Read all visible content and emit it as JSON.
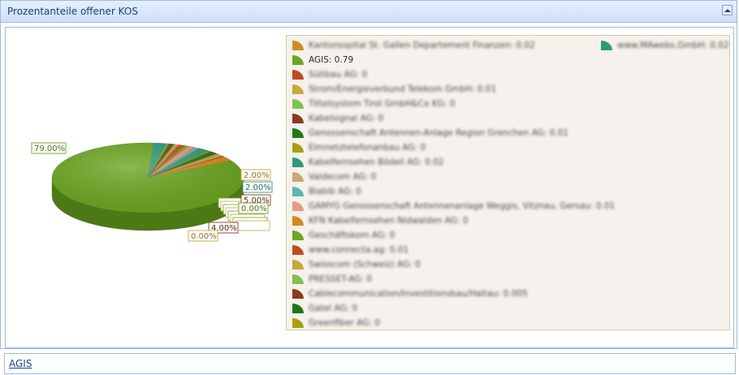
{
  "panel": {
    "title": "Prozentanteile offener KOS"
  },
  "footer": {
    "link_label": "AGIS"
  },
  "colors": {
    "header_text": "#15428b",
    "border": "#99bbe8",
    "legend_bg": "#f5f1ec"
  },
  "chart_data": {
    "type": "pie",
    "style": "3d",
    "legend_placement": "right",
    "series": [
      {
        "name": "Kantonsspital St. Gallen Departement Finanzen: 0.02",
        "value": 0.02,
        "color": "#d18b1c"
      },
      {
        "name": "AGIS: 0.79",
        "value": 0.79,
        "color": "#6aa61e"
      },
      {
        "name": "Sütibau AG: 0",
        "value": 0,
        "color": "#c34a1e"
      },
      {
        "name": "Strom/Energieverbund Telekom GmbH: 0.01",
        "value": 0.01,
        "color": "#c8a83a"
      },
      {
        "name": "Tittelsystem Tirol GmbH&Co KG: 0",
        "value": 0,
        "color": "#7ec24a"
      },
      {
        "name": "Kabelsignal AG: 0",
        "value": 0,
        "color": "#8b3a1e"
      },
      {
        "name": "Genossenschaft Antennen-Anlage Region Grenchen AG: 0.01",
        "value": 0.01,
        "color": "#1a7a0e"
      },
      {
        "name": "Elmnetztelefonanbau AG: 0",
        "value": 0,
        "color": "#a8a010"
      },
      {
        "name": "Kabelfernsehen Bödeli AG: 0.02",
        "value": 0.02,
        "color": "#2f9a7a"
      },
      {
        "name": "Valdecom AG: 0",
        "value": 0,
        "color": "#c8a878"
      },
      {
        "name": "Biabib AG: 0",
        "value": 0,
        "color": "#5ab8b0"
      },
      {
        "name": "GAMYG Genossenschaft Antennenanlage Weggis, Vitznau, Gersau: 0.01",
        "value": 0.01,
        "color": "#e89a80"
      },
      {
        "name": "KFN Kabelfernsehen Nidwalden AG: 0",
        "value": 0,
        "color": "#d18b1c"
      },
      {
        "name": "Geschäftskom AG: 0",
        "value": 0,
        "color": "#6aa61e"
      },
      {
        "name": "www.connecta.ag: 0.01",
        "value": 0.01,
        "color": "#c34a1e"
      },
      {
        "name": "Swisscom (Schweiz) AG: 0",
        "value": 0,
        "color": "#c8a83a"
      },
      {
        "name": "PRESSET-AG: 0",
        "value": 0,
        "color": "#7ec24a"
      },
      {
        "name": "Cablecommunication/Investitionsbau/Haltau: 0.005",
        "value": 0.005,
        "color": "#8b3a1e"
      },
      {
        "name": "Gatel AG: 0",
        "value": 0,
        "color": "#1a7a0e"
      },
      {
        "name": "Greenfiber AG: 0",
        "value": 0,
        "color": "#a8a010"
      },
      {
        "name": "www.MAwebs.GmbH: 0.02",
        "value": 0.02,
        "color": "#2f9a7a"
      }
    ],
    "data_labels": [
      "79.00%",
      "2.00%",
      "2.00%",
      "5.00%",
      "0.00%",
      "4.00%",
      "0.00%"
    ]
  }
}
